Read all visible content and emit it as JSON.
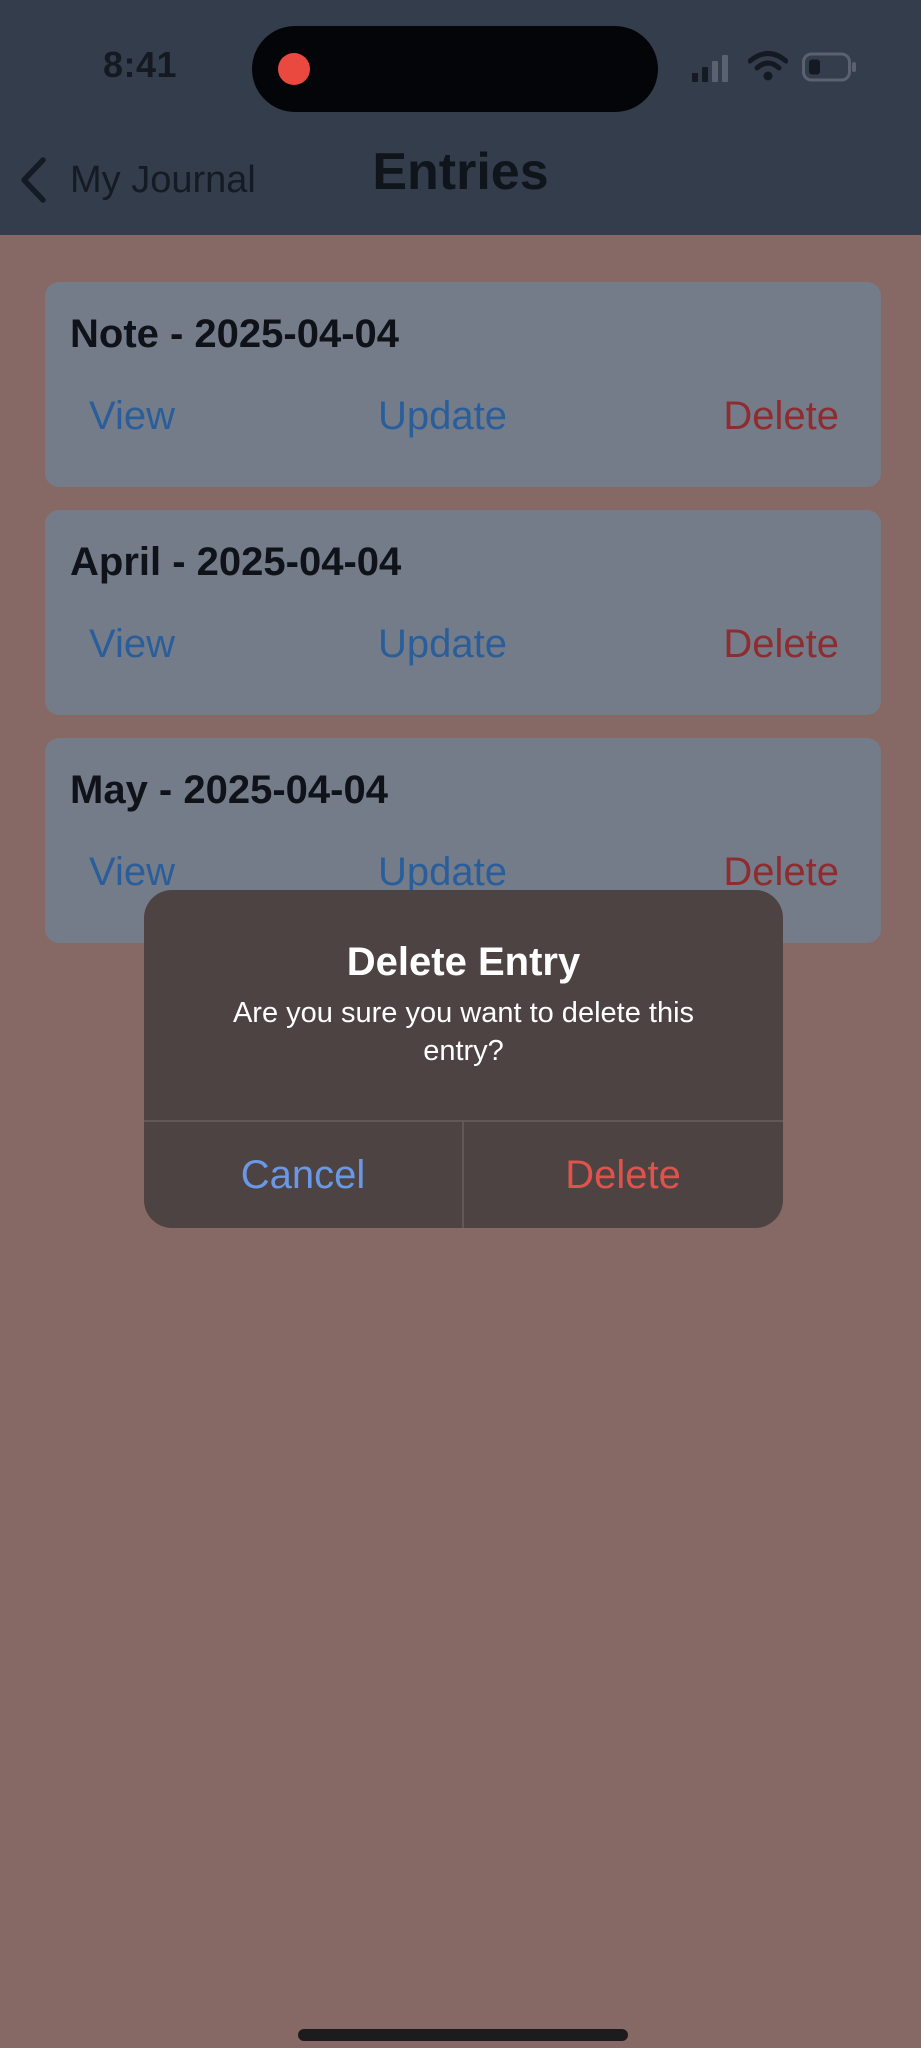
{
  "status_bar": {
    "time": "8:41",
    "icons": [
      "signal-icon",
      "wifi-icon",
      "battery-icon"
    ],
    "recording_indicator": "screen-recording-dot"
  },
  "nav": {
    "back_label": "My Journal",
    "title": "Entries"
  },
  "entries": [
    {
      "title": "Note - 2025-04-04",
      "view": "View",
      "update": "Update",
      "delete": "Delete"
    },
    {
      "title": "April - 2025-04-04",
      "view": "View",
      "update": "Update",
      "delete": "Delete"
    },
    {
      "title": "May - 2025-04-04",
      "view": "View",
      "update": "Update",
      "delete": "Delete"
    }
  ],
  "alert": {
    "title": "Delete Entry",
    "message": "Are you sure you want to delete this entry?",
    "cancel_label": "Cancel",
    "delete_label": "Delete"
  },
  "colors": {
    "header_background": "#343d4c",
    "page_background": "#866864",
    "link_blue": "#2a5e9b",
    "destructive_red": "#e0524b",
    "alert_background": "#4d4342"
  }
}
